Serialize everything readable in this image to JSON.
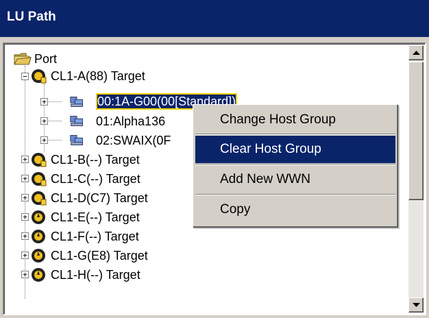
{
  "window": {
    "title": "LU Path"
  },
  "tree": {
    "root": {
      "label": "Port",
      "icon": "folder-icon"
    },
    "ports": [
      {
        "label": "CL1-A(88) Target",
        "expanded": true
      },
      {
        "label": "CL1-B(--) Target",
        "expanded": false
      },
      {
        "label": "CL1-C(--) Target",
        "expanded": false
      },
      {
        "label": "CL1-D(C7) Target",
        "expanded": false
      },
      {
        "label": "CL1-E(--) Target",
        "expanded": false
      },
      {
        "label": "CL1-F(--) Target",
        "expanded": false
      },
      {
        "label": "CL1-G(E8) Target",
        "expanded": false
      },
      {
        "label": "CL1-H(--) Target",
        "expanded": false
      }
    ],
    "host_groups": [
      {
        "label": "00:1A-G00(00[Standard])",
        "selected": true
      },
      {
        "label": "01:Alpha136",
        "selected": false
      },
      {
        "label": "02:SWAIX(0F",
        "selected": false
      }
    ]
  },
  "context_menu": {
    "items": [
      {
        "label": "Change Host Group",
        "highlighted": false
      },
      {
        "label": "Clear Host Group",
        "highlighted": true
      },
      {
        "label": "Add New WWN",
        "highlighted": false
      },
      {
        "label": "Copy",
        "highlighted": false
      }
    ]
  },
  "colors": {
    "titlebar": "#0a246a",
    "highlight": "#0a246a",
    "selection_border": "#e8d000",
    "background": "#d4d0c8"
  }
}
